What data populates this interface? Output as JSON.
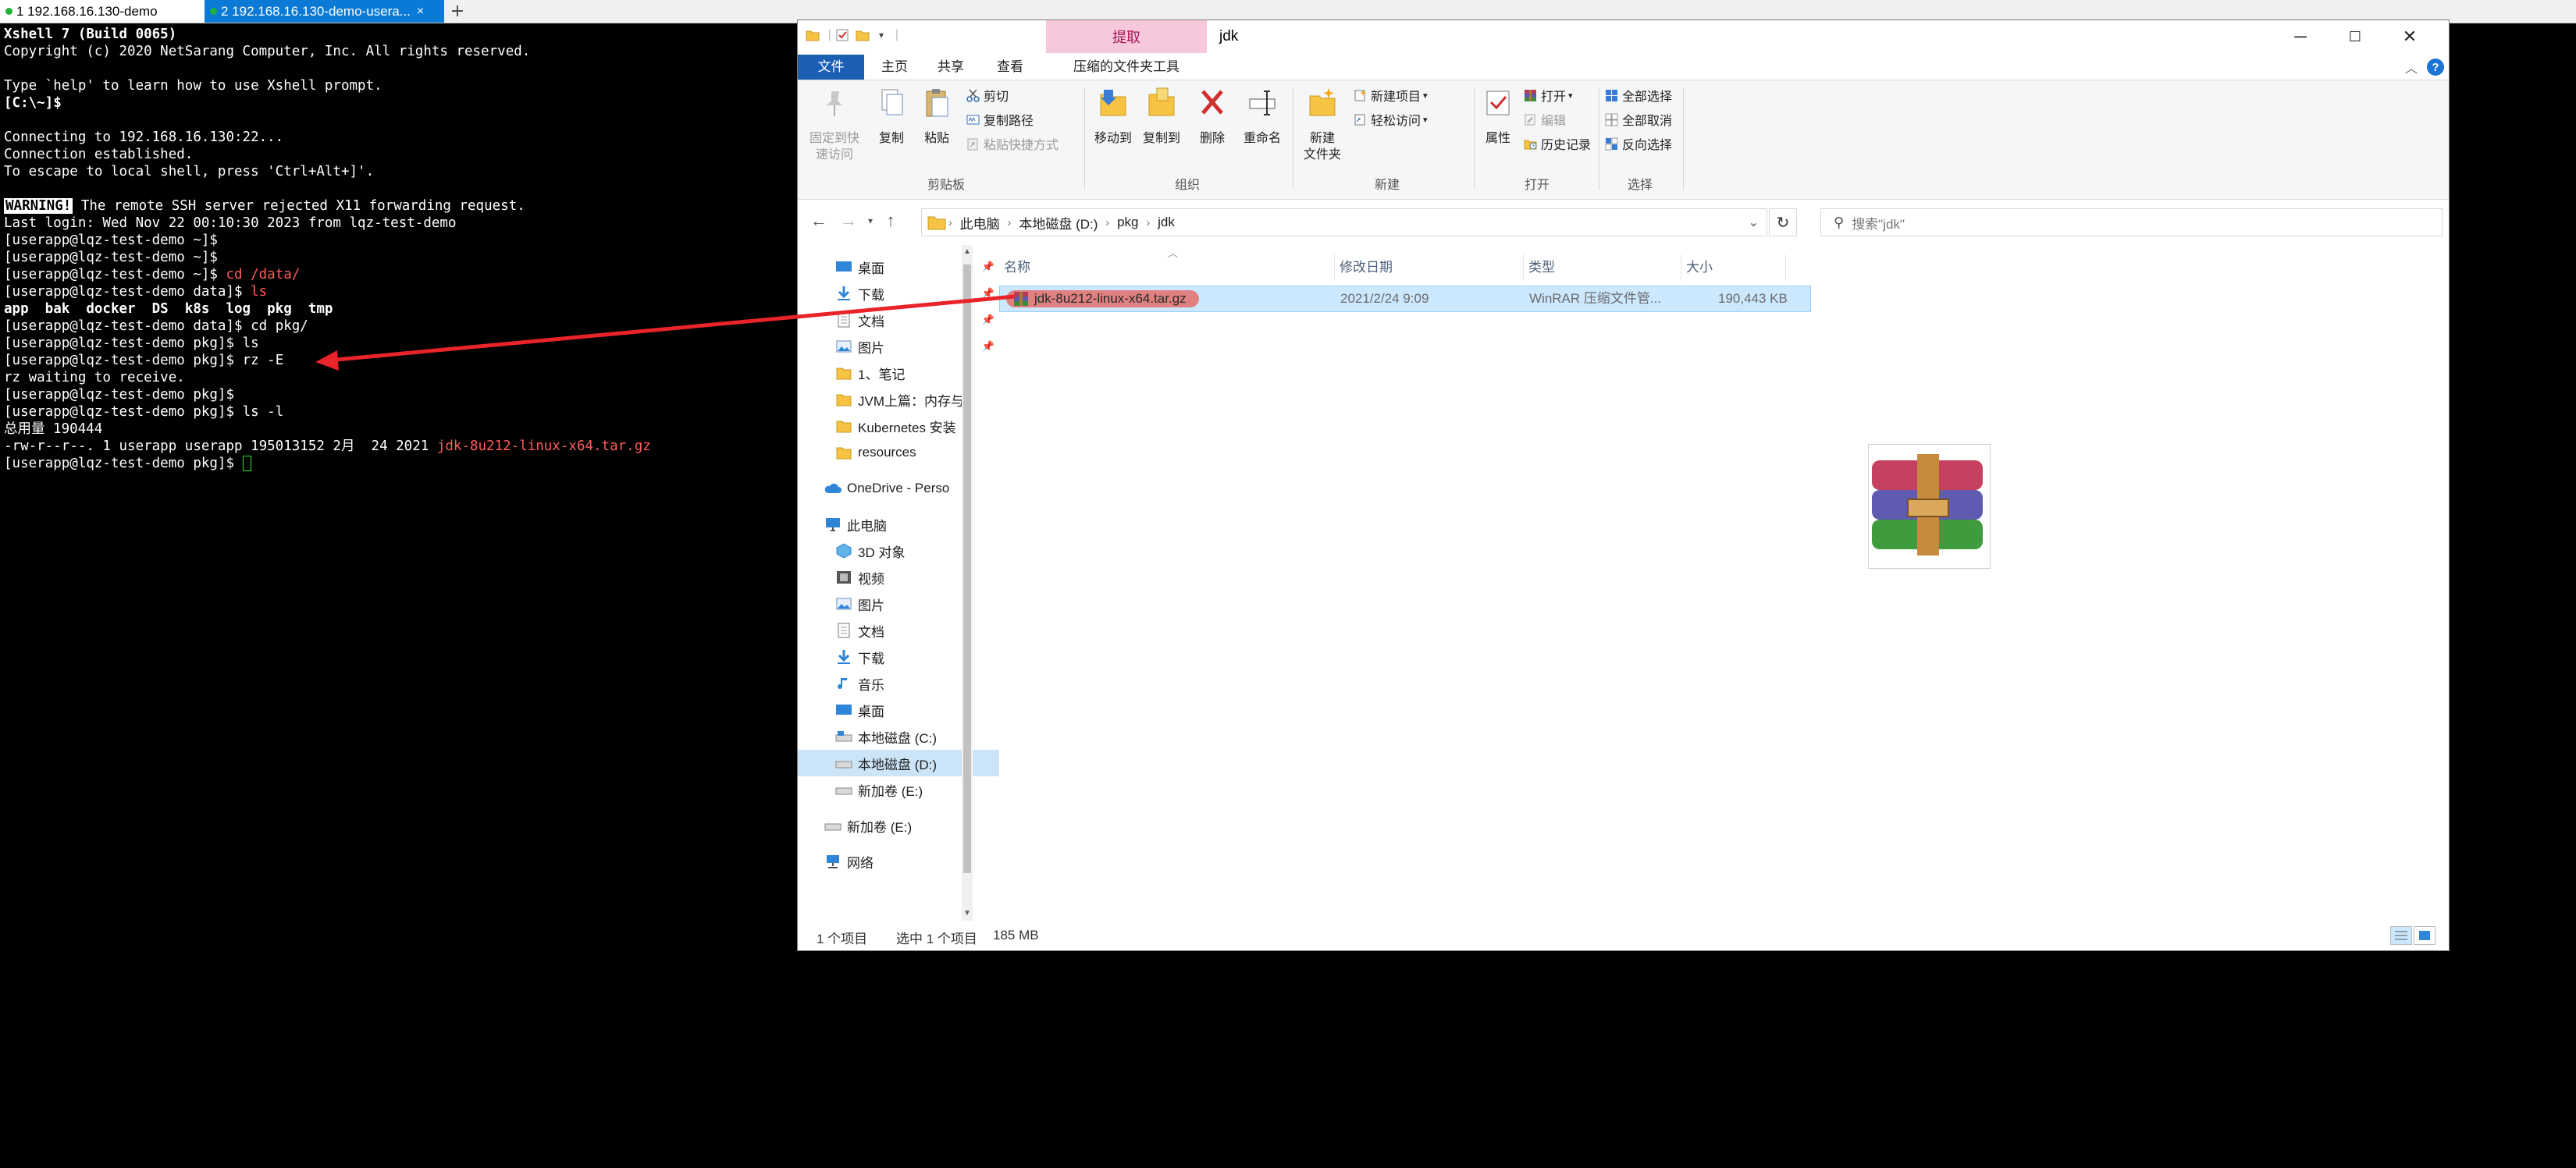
{
  "xshell": {
    "tabs": [
      {
        "label": "1 192.168.16.130-demo"
      },
      {
        "label": "2 192.168.16.130-demo-usera...",
        "close": "×"
      }
    ],
    "add_tab": "+"
  },
  "terminal": {
    "title_line": "Xshell 7 (Build 0065)",
    "copyright": "Copyright (c) 2020 NetSarang Computer, Inc. All rights reserved.",
    "help_line": "Type `help' to learn how to use Xshell prompt.",
    "local_prompt": "[C:\\~]$",
    "connecting": "Connecting to 192.168.16.130:22...",
    "established": "Connection established.",
    "escape": "To escape to local shell, press 'Ctrl+Alt+]'.",
    "warning_label": "WARNING!",
    "warning_text": " The remote SSH server rejected X11 forwarding request.",
    "last_login": "Last login: Wed Nov 22 00:10:30 2023 from lqz-test-demo",
    "prompt_home": "[userapp@lqz-test-demo ~]$",
    "cmd_cd_data": "cd /data/",
    "prompt_data": "[userapp@lqz-test-demo data]$",
    "cmd_ls": "ls",
    "ls_dirs": "app  bak  docker  DS  k8s  log  pkg  tmp",
    "cmd_cd_pkg": "cd pkg/",
    "prompt_pkg": "[userapp@lqz-test-demo pkg]$",
    "cmd_rz": "rz -E",
    "rz_wait": "rz waiting to receive.",
    "cmd_ls_l": "ls -l",
    "total": "总用量 190444",
    "file_line_prefix": "-rw-r--r--. 1 userapp userapp 195013152 2月  24 2021 ",
    "file_name": "jdk-8u212-linux-x64.tar.gz"
  },
  "explorer": {
    "title": "jdk",
    "contextual_tab": "提取",
    "ribbon_tabs": [
      "文件",
      "主页",
      "共享",
      "查看",
      "压缩的文件夹工具"
    ],
    "clipboard": {
      "pin_label_1": "固定到快",
      "pin_label_2": "速访问",
      "copy": "复制",
      "paste": "粘贴",
      "cut": "剪切",
      "copy_path": "复制路径",
      "paste_shortcut": "粘贴快捷方式",
      "group": "剪贴板"
    },
    "organize": {
      "move_to": "移动到",
      "copy_to": "复制到",
      "delete": "删除",
      "rename": "重命名",
      "group": "组织"
    },
    "new": {
      "new_folder_1": "新建",
      "new_folder_2": "文件夹",
      "new_item": "新建项目",
      "easy_access": "轻松访问",
      "group": "新建"
    },
    "open": {
      "properties": "属性",
      "open": "打开",
      "edit": "编辑",
      "history": "历史记录",
      "group": "打开"
    },
    "select": {
      "select_all": "全部选择",
      "select_none": "全部取消",
      "invert": "反向选择",
      "group": "选择"
    },
    "address": {
      "crumbs": [
        "此电脑",
        "本地磁盘 (D:)",
        "pkg",
        "jdk"
      ]
    },
    "search_placeholder": "搜索\"jdk\"",
    "nav": [
      {
        "label": "桌面"
      },
      {
        "label": "下载"
      },
      {
        "label": "文档"
      },
      {
        "label": "图片"
      },
      {
        "label": "1、笔记"
      },
      {
        "label": "JVM上篇：内存与"
      },
      {
        "label": "Kubernetes 安装"
      },
      {
        "label": "resources"
      },
      {
        "label": "OneDrive - Perso"
      },
      {
        "label": "此电脑"
      },
      {
        "label": "3D 对象"
      },
      {
        "label": "视频"
      },
      {
        "label": "图片"
      },
      {
        "label": "文档"
      },
      {
        "label": "下载"
      },
      {
        "label": "音乐"
      },
      {
        "label": "桌面"
      },
      {
        "label": "本地磁盘 (C:)"
      },
      {
        "label": "本地磁盘 (D:)"
      },
      {
        "label": "新加卷 (E:)"
      },
      {
        "label": "新加卷 (E:)"
      },
      {
        "label": "网络"
      }
    ],
    "columns": [
      "名称",
      "修改日期",
      "类型",
      "大小"
    ],
    "files": [
      {
        "name": "jdk-8u212-linux-x64.tar.gz",
        "modified": "2021/2/24 9:09",
        "type": "WinRAR 压缩文件管...",
        "size": "190,443 KB"
      }
    ],
    "status": {
      "count": "1 个项目",
      "selected": "选中 1 个项目",
      "size": "185 MB"
    }
  },
  "colors": {
    "arrow": "#e8232a",
    "terminal_bg": "#000000",
    "prompt_green": "#33e633",
    "ls_dir_blue": "#4aa3ff",
    "highlight_red": "#ff5b5b",
    "file_tab_blue": "#1a5fb4",
    "extract_pink": "#f7c7dc",
    "selection": "#cce8ff"
  }
}
